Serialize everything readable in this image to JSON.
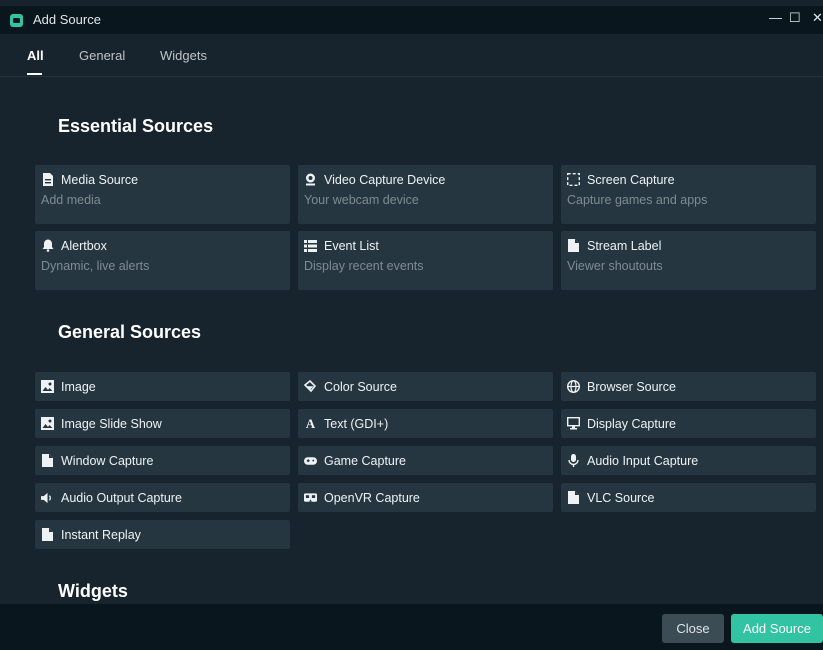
{
  "window": {
    "title": "Add Source",
    "controls": {
      "minimize": "—",
      "maximize": "☐",
      "close": "✕"
    }
  },
  "tabs": [
    {
      "label": "All"
    },
    {
      "label": "General"
    },
    {
      "label": "Widgets"
    }
  ],
  "sections": {
    "essential": {
      "title": "Essential Sources"
    },
    "general": {
      "title": "General Sources"
    },
    "widgets": {
      "title": "Widgets"
    }
  },
  "essential_sources": [
    {
      "label": "Media Source",
      "description": "Add media",
      "icon": "file-icon"
    },
    {
      "label": "Video Capture Device",
      "description": "Your webcam device",
      "icon": "webcam-icon"
    },
    {
      "label": "Screen Capture",
      "description": "Capture games and apps",
      "icon": "screen-capture-icon"
    },
    {
      "label": "Alertbox",
      "description": "Dynamic, live alerts",
      "icon": "bell-icon"
    },
    {
      "label": "Event List",
      "description": "Display recent events",
      "icon": "list-icon"
    },
    {
      "label": "Stream Label",
      "description": "Viewer shoutouts",
      "icon": "file-icon"
    }
  ],
  "general_sources": [
    {
      "label": "Image",
      "icon": "image-icon"
    },
    {
      "label": "Color Source",
      "icon": "paint-bucket-icon"
    },
    {
      "label": "Browser Source",
      "icon": "globe-icon"
    },
    {
      "label": "Image Slide Show",
      "icon": "image-icon"
    },
    {
      "label": "Text (GDI+)",
      "icon": "text-icon"
    },
    {
      "label": "Display Capture",
      "icon": "monitor-icon"
    },
    {
      "label": "Window Capture",
      "icon": "file-icon"
    },
    {
      "label": "Game Capture",
      "icon": "gamepad-icon"
    },
    {
      "label": "Audio Input Capture",
      "icon": "microphone-icon"
    },
    {
      "label": "Audio Output Capture",
      "icon": "speaker-icon"
    },
    {
      "label": "OpenVR Capture",
      "icon": "vr-headset-icon"
    },
    {
      "label": "VLC Source",
      "icon": "file-icon"
    },
    {
      "label": "Instant Replay",
      "icon": "file-icon"
    }
  ],
  "footer": {
    "close_label": "Close",
    "add_label": "Add Source"
  },
  "colors": {
    "background": "#17242d",
    "card": "#263640",
    "accent": "#31c3a2",
    "titlebar": "#09161d"
  }
}
